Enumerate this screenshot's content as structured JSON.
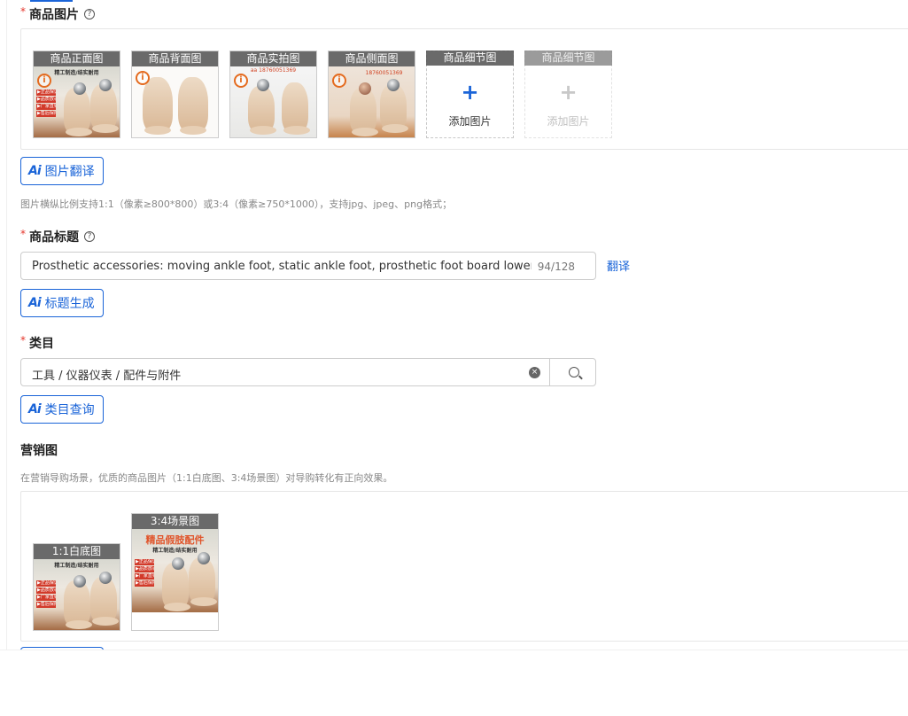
{
  "product_images": {
    "required_mark": "*",
    "label": "商品图片",
    "help": "?",
    "slots": [
      {
        "caption": "商品正面图",
        "type": "photo"
      },
      {
        "caption": "商品背面图",
        "type": "photo"
      },
      {
        "caption": "商品实拍图",
        "type": "photo"
      },
      {
        "caption": "商品侧面图",
        "type": "photo"
      },
      {
        "caption": "商品细节图",
        "type": "add",
        "add_text": "添加图片"
      },
      {
        "caption": "商品细节图",
        "type": "add-disabled",
        "add_text": "添加图片"
      }
    ],
    "photo_texts": {
      "slogan": "精工制造/结实耐用",
      "checks": [
        "▶正品保证",
        "▶品质放心",
        "▶厂家直销",
        "▶售后保障"
      ],
      "phone_a": "aa 18760051369",
      "phone_b": "18760051369"
    },
    "ai_button": {
      "mark": "Ai",
      "label": "图片翻译"
    },
    "hint": "图片横纵比例支持1:1（像素≥800*800）或3:4（像素≥750*1000），支持jpg、jpeg、png格式；"
  },
  "product_title": {
    "required_mark": "*",
    "label": "商品标题",
    "help": "?",
    "value": "Prosthetic accessories: moving ankle foot, static ankle foot, prosthetic foot board lower limb",
    "count": "94/128",
    "translate": "翻译",
    "ai_button": {
      "mark": "Ai",
      "label": "标题生成"
    }
  },
  "category": {
    "required_mark": "*",
    "label": "类目",
    "value": "工具 / 仪器仪表 / 配件与附件",
    "clear": "×",
    "ai_button": {
      "mark": "Ai",
      "label": "类目查询"
    }
  },
  "marketing": {
    "label": "营销图",
    "hint": "在营销导购场景，优质的商品图片（1:1白底图、3:4场景图）对导购转化有正向效果。",
    "images": [
      {
        "caption": "1:1白底图"
      },
      {
        "caption": "3:4场景图",
        "scene_title": "精品假肢配件"
      }
    ]
  }
}
